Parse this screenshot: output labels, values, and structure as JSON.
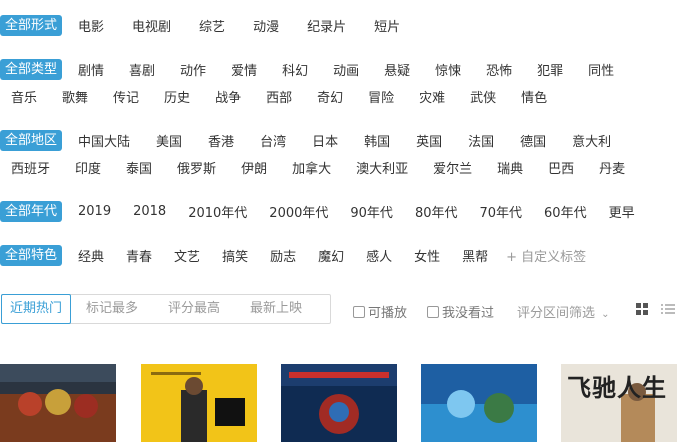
{
  "filters": {
    "form": {
      "selected": "全部形式",
      "options": [
        "电影",
        "电视剧",
        "综艺",
        "动漫",
        "纪录片",
        "短片"
      ]
    },
    "type": {
      "selected": "全部类型",
      "options_line1": [
        "剧情",
        "喜剧",
        "动作",
        "爱情",
        "科幻",
        "动画",
        "悬疑",
        "惊悚",
        "恐怖",
        "犯罪",
        "同性"
      ],
      "options_line2": [
        "音乐",
        "歌舞",
        "传记",
        "历史",
        "战争",
        "西部",
        "奇幻",
        "冒险",
        "灾难",
        "武侠",
        "情色"
      ]
    },
    "region": {
      "selected": "全部地区",
      "options_line1": [
        "中国大陆",
        "美国",
        "香港",
        "台湾",
        "日本",
        "韩国",
        "英国",
        "法国",
        "德国",
        "意大利"
      ],
      "options_line2": [
        "西班牙",
        "印度",
        "泰国",
        "俄罗斯",
        "伊朗",
        "加拿大",
        "澳大利亚",
        "爱尔兰",
        "瑞典",
        "巴西",
        "丹麦"
      ]
    },
    "era": {
      "selected": "全部年代",
      "options": [
        "2019",
        "2018",
        "2010年代",
        "2000年代",
        "90年代",
        "80年代",
        "70年代",
        "60年代",
        "更早"
      ]
    },
    "feature": {
      "selected": "全部特色",
      "options": [
        "经典",
        "青春",
        "文艺",
        "搞笑",
        "励志",
        "魔幻",
        "感人",
        "女性",
        "黑帮"
      ],
      "custom_tag": "+ 自定义标签"
    }
  },
  "sort_tabs": [
    "近期热门",
    "标记最多",
    "评分最高",
    "最新上映"
  ],
  "checkboxes": {
    "playable": "可播放",
    "not_seen": "我没看过"
  },
  "score_range_label": "评分区间筛选",
  "poster_title_text": "飞驰人生",
  "colors": {
    "accent": "#3a9fd6"
  }
}
